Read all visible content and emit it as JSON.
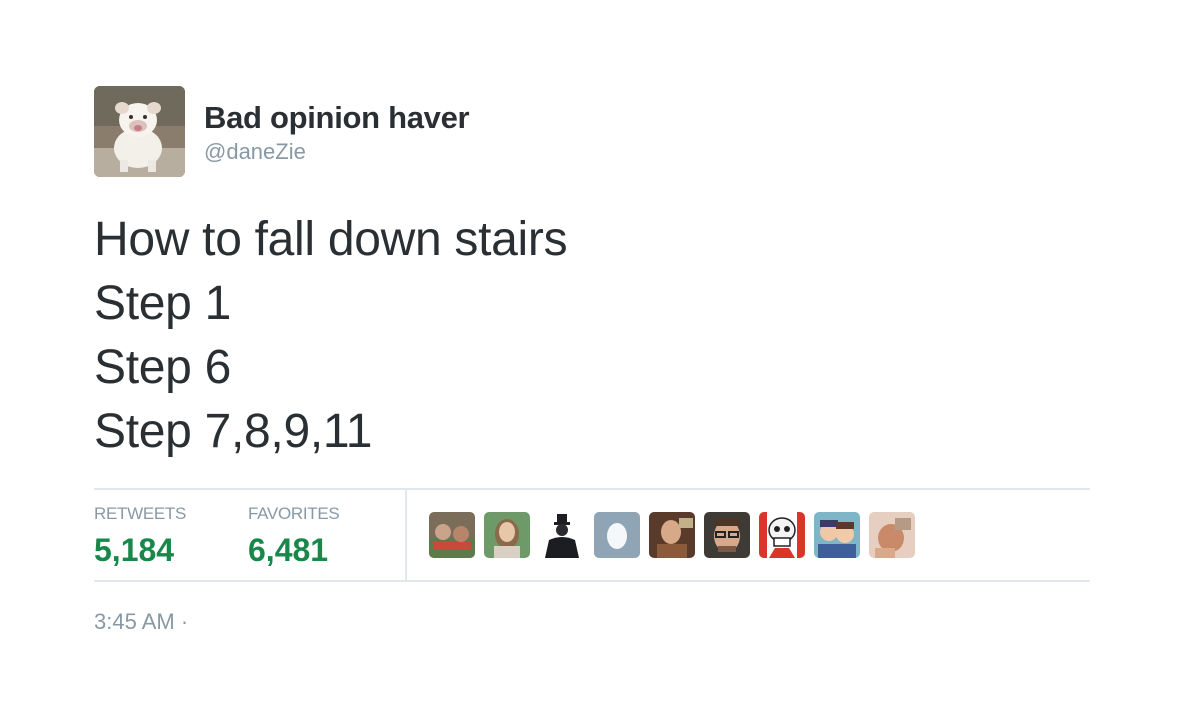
{
  "user": {
    "display_name": "Bad opinion haver",
    "handle": "@daneZie",
    "avatar_icon": "bulldog-photo"
  },
  "tweet": {
    "lines": [
      "How to fall down stairs",
      "Step 1",
      "Step 6",
      "Step 7,8,9,11"
    ],
    "timestamp": "3:45 AM ·"
  },
  "stats": {
    "retweets_label": "RETWEETS",
    "retweets_count": "5,184",
    "favorites_label": "FAVORITES",
    "favorites_count": "6,481"
  },
  "colors": {
    "text": "#292f33",
    "secondary": "#8899a6",
    "count_green": "#17874a",
    "rule": "#e1e8ed"
  }
}
